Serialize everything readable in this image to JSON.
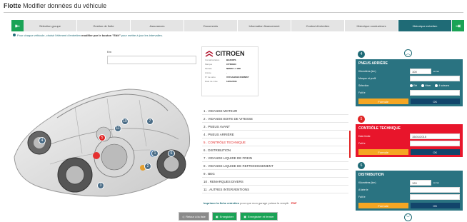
{
  "page": {
    "title_bold": "Flotte",
    "title_rest": " Modifier données du véhicule"
  },
  "tabs": [
    {
      "label": "Sélection groupe"
    },
    {
      "label": "Gestion de flotte"
    },
    {
      "label": "Assurances"
    },
    {
      "label": "Documents"
    },
    {
      "label": "Information financement"
    },
    {
      "label": "Contrat d'entretien"
    },
    {
      "label": "Historique conducteurs"
    },
    {
      "label": "Historique entretien",
      "active": true
    }
  ],
  "info": {
    "text_pre": "Pour chaque véhicule, choisir l'élément d'entretien ",
    "text_bold": "modifier par le bouton \"Edit\"",
    "text_post": " pour mettre à jour les intervalles."
  },
  "car": {
    "markers": [
      "4",
      "11",
      "10",
      "7",
      "6",
      "5",
      "1",
      "2",
      "3"
    ],
    "km_label": "Km"
  },
  "vehicle": {
    "brand": "CITROEN",
    "fields": [
      {
        "k": "Immatriculation",
        "v": "BG260PS"
      },
      {
        "k": "Marque",
        "v": "CITROEN"
      },
      {
        "k": "Modèle",
        "v": "NEMO 1.4 HDI"
      },
      {
        "k": "Année",
        "v": "-"
      },
      {
        "k": "N° de série",
        "v": "VF7AAHFHC45186957"
      },
      {
        "k": "Date de mise",
        "v": "14/01/2011"
      }
    ]
  },
  "menu": [
    {
      "label": "1 .  VIDANGE MOTEUR"
    },
    {
      "label": "2 .  VIDANGE BOITE DE VITESSE"
    },
    {
      "label": "3 .  PNEUS AVANT"
    },
    {
      "label": "4 .  PNEUS ARRIÈRE"
    },
    {
      "label": "5 .  CONTRÔLE TECHNIQUE",
      "highlight": true
    },
    {
      "label": "6 .  DISTRIBUTION"
    },
    {
      "label": "7 .  VIDANGE LIQUIDE DE FREIN"
    },
    {
      "label": "8 .  VIDANGE LIQUIDE DE REFROIDISSEMENT"
    },
    {
      "label": "9 .  BEG"
    },
    {
      "label": "10 .  REMARQUES DIVERS"
    },
    {
      "label": "11 .  AUTRES INTERVENTIONS"
    }
  ],
  "print": {
    "link": "Imprimer la fiche entretien",
    "rest": " pour que mon garage puisse la remplir",
    "pdf": "PDF"
  },
  "buttons": {
    "back": "Retour à la liste",
    "save": "Enregistrer",
    "save_close": "Enregistrer et fermer"
  },
  "panels": {
    "p4": {
      "num": "4",
      "title": "PNEUS ARRIÈRE",
      "km_label": "Kilomètres (km)",
      "km_value": "100",
      "km_unit": "km/an",
      "brand_label": "Marque et profil",
      "selection_label": "Sélection",
      "radios": [
        "Eté",
        "Hiver",
        "4 saisons"
      ],
      "done_label": "Fait le",
      "edit": "Formule",
      "ok": "OK"
    },
    "p5": {
      "num": "5",
      "title": "CONTRÔLE TECHNIQUE",
      "date_label": "Date limite",
      "date_value": "15/01/2015",
      "done_label": "Fait le",
      "edit": "Formule",
      "ok": "OK"
    },
    "p6": {
      "num": "6",
      "title": "DISTRIBUTION",
      "km_label": "Kilomètres (km)",
      "km_value": "120",
      "km_unit": "km/an",
      "date_label": "A faire le",
      "done_label": "Fait le",
      "edit": "Formule",
      "ok": "OK"
    }
  },
  "colors": {
    "teal": "#1f6b76",
    "green": "#1aa356",
    "red": "#e8152b",
    "orange": "#f5a623"
  }
}
